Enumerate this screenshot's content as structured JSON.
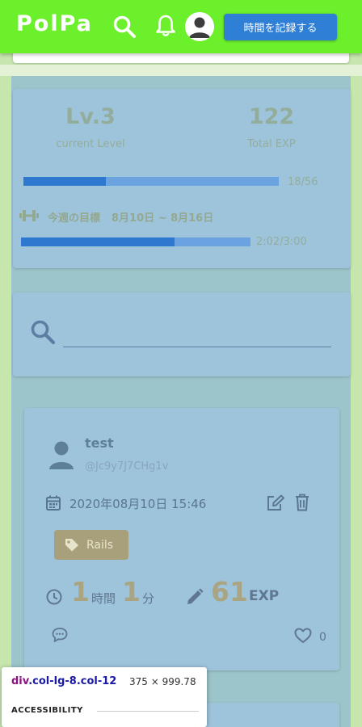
{
  "header": {
    "logo": "PolPa",
    "record_button": "時間を記録する",
    "icons": [
      "search-icon",
      "bell-icon",
      "account-icon"
    ]
  },
  "level_card": {
    "level": "Lv.3",
    "level_label": "current Level",
    "total_exp": "122",
    "total_exp_label": "Total EXP",
    "exp_progress": {
      "current": 18,
      "max": 56,
      "text": "18/56"
    },
    "goal_label": "今週の目標",
    "goal_range": "8月10日 ~ 8月16日",
    "goal_progress": {
      "fraction": 0.67,
      "text": "2:02/3:00"
    }
  },
  "search": {
    "placeholder": ""
  },
  "post": {
    "username": "test",
    "user_id": "@Jc9y7J7CHg1v",
    "datetime": "2020年08月10日 15:46",
    "tag": "Rails",
    "hours": "1",
    "hours_unit": "時間",
    "minutes": "1",
    "minutes_unit": "分",
    "exp": "61",
    "exp_unit": "EXP",
    "likes": "0"
  },
  "devtools_tooltip": {
    "tag": "div",
    "classes": ".col-lg-8.col-12",
    "size": "375 × 999.78",
    "section": "ACCESSIBILITY"
  },
  "colors": {
    "appbar": "#6df02c",
    "record_button": "#2f7fd6",
    "highlight": "#78aae1",
    "background": "#c6e6ae"
  }
}
